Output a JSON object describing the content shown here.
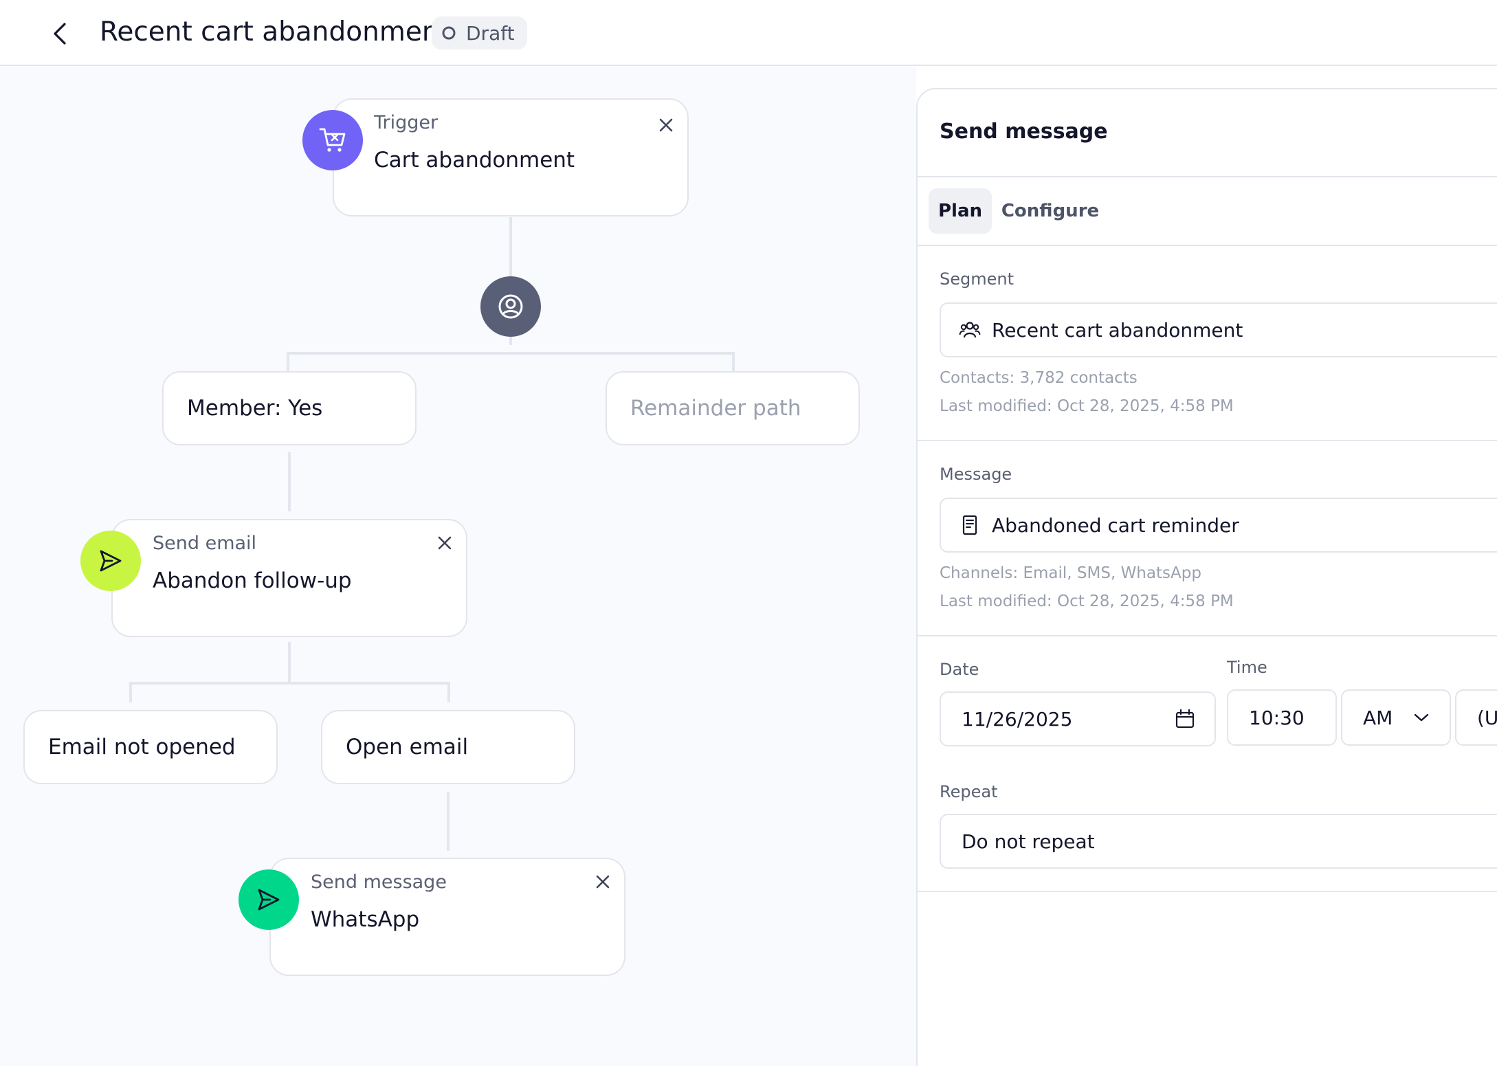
{
  "header": {
    "title": "Recent cart abandonment",
    "status": "Draft"
  },
  "flow": {
    "trigger": {
      "kind": "Trigger",
      "name": "Cart abandonment",
      "icon": "cart-x-icon",
      "color": "#7063f6"
    },
    "split": {
      "icon": "user-circle-icon",
      "color": "#5a5f78"
    },
    "branch_yes": "Member: Yes",
    "branch_remainder": "Remainder path",
    "send_email": {
      "kind": "Send email",
      "name": "Abandon follow-up",
      "icon": "send-icon",
      "color": "#c8f542"
    },
    "branch_not_opened": "Email not opened",
    "branch_opened": "Open email",
    "send_message": {
      "kind": "Send message",
      "name": "WhatsApp",
      "icon": "send-icon",
      "color": "#00d78a"
    }
  },
  "panel": {
    "title": "Send message",
    "tabs": [
      {
        "label": "Plan",
        "active": true
      },
      {
        "label": "Configure",
        "active": false
      }
    ],
    "segment": {
      "label": "Segment",
      "value": "Recent cart abandonment",
      "contacts": "Contacts: 3,782 contacts",
      "modified": "Last modified: Oct 28, 2025, 4:58 PM"
    },
    "message": {
      "label": "Message",
      "value": "Abandoned cart reminder",
      "channels": "Channels: Email, SMS, WhatsApp",
      "modified": "Last modified: Oct 28, 2025, 4:58 PM"
    },
    "date": {
      "label": "Date",
      "value": "11/26/2025"
    },
    "time": {
      "label": "Time",
      "value": "10:30",
      "period": "AM",
      "timezone": "(UT"
    },
    "repeat": {
      "label": "Repeat",
      "value": "Do not repeat"
    }
  }
}
